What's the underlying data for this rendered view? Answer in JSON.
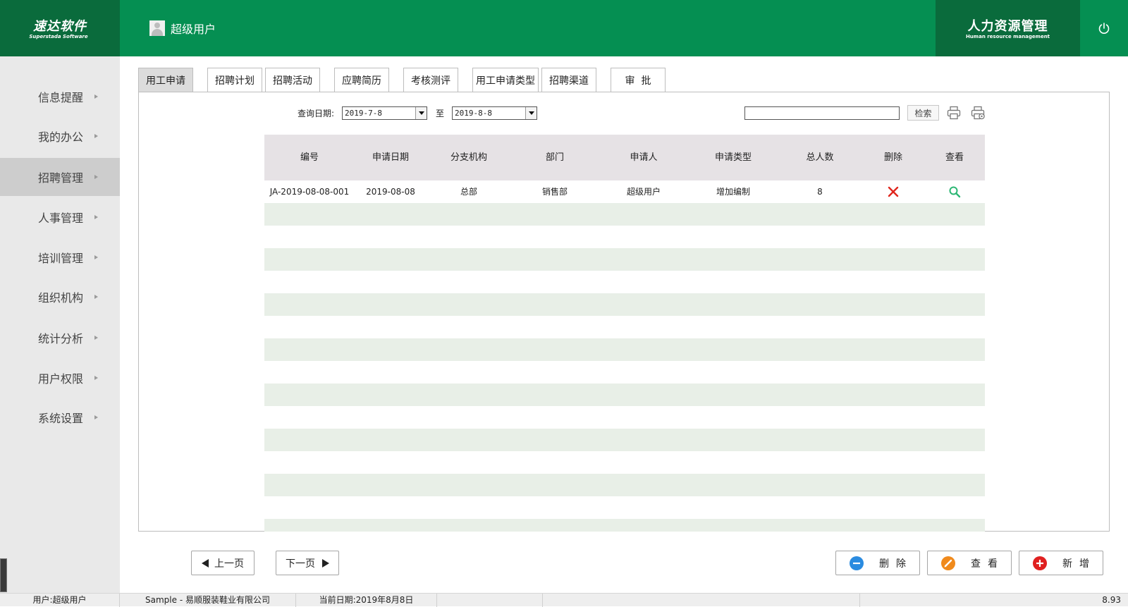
{
  "header": {
    "logo_cn": "速达软件",
    "logo_en": "Superstada Software",
    "user_name": "超级用户",
    "module_cn": "人力资源管理",
    "module_en": "Human resource management",
    "power_icon": "power-icon",
    "colors": {
      "header_green": "#058f52",
      "dark_green": "#0a6b3c"
    }
  },
  "sidebar": {
    "items": [
      {
        "label": "信息提醒",
        "active": false
      },
      {
        "label": "我的办公",
        "active": false
      },
      {
        "label": "招聘管理",
        "active": true
      },
      {
        "label": "人事管理",
        "active": false
      },
      {
        "label": "培训管理",
        "active": false
      },
      {
        "label": "组织机构",
        "active": false
      },
      {
        "label": "统计分析",
        "active": false
      },
      {
        "label": "用户权限",
        "active": false
      },
      {
        "label": "系统设置",
        "active": false
      }
    ]
  },
  "tabs": [
    {
      "label": "用工申请",
      "active": true
    },
    {
      "label": "招聘计划",
      "active": false
    },
    {
      "label": "招聘活动",
      "active": false
    },
    {
      "label": "应聘简历",
      "active": false
    },
    {
      "label": "考核测评",
      "active": false
    },
    {
      "label": "用工申请类型",
      "active": false
    },
    {
      "label": "招聘渠道",
      "active": false
    },
    {
      "label": "审  批",
      "active": false
    }
  ],
  "query": {
    "label": "查询日期:",
    "from": "2019-7-8",
    "to_label": "至",
    "to": "2019-8-8",
    "search_value": "",
    "search_button": "检索",
    "print_icon": "printer-icon",
    "print_setup_icon": "printer-settings-icon"
  },
  "table": {
    "columns": [
      "编号",
      "申请日期",
      "分支机构",
      "部门",
      "申请人",
      "申请类型",
      "总人数",
      "删除",
      "查看"
    ],
    "rows": [
      {
        "id": "JA-2019-08-08-001",
        "date": "2019-08-08",
        "branch": "总部",
        "dept": "销售部",
        "applicant": "超级用户",
        "type": "增加编制",
        "count": "8",
        "delete_icon": "delete-x-icon",
        "view_icon": "search-icon"
      }
    ]
  },
  "pager": {
    "prev": "上一页",
    "next": "下一页"
  },
  "actions": {
    "delete": {
      "label": "删除",
      "icon": "minus-circle-icon",
      "color": "#2a8be0"
    },
    "view": {
      "label": "查看",
      "icon": "edit-pencil-icon",
      "color": "#f08a1c"
    },
    "add": {
      "label": "新增",
      "icon": "plus-circle-icon",
      "color": "#e02020"
    }
  },
  "status_bar": {
    "user": "用户:超级用户",
    "company": "Sample - 易顺服装鞋业有限公司",
    "date": "当前日期:2019年8月8日",
    "version": "8.93"
  }
}
